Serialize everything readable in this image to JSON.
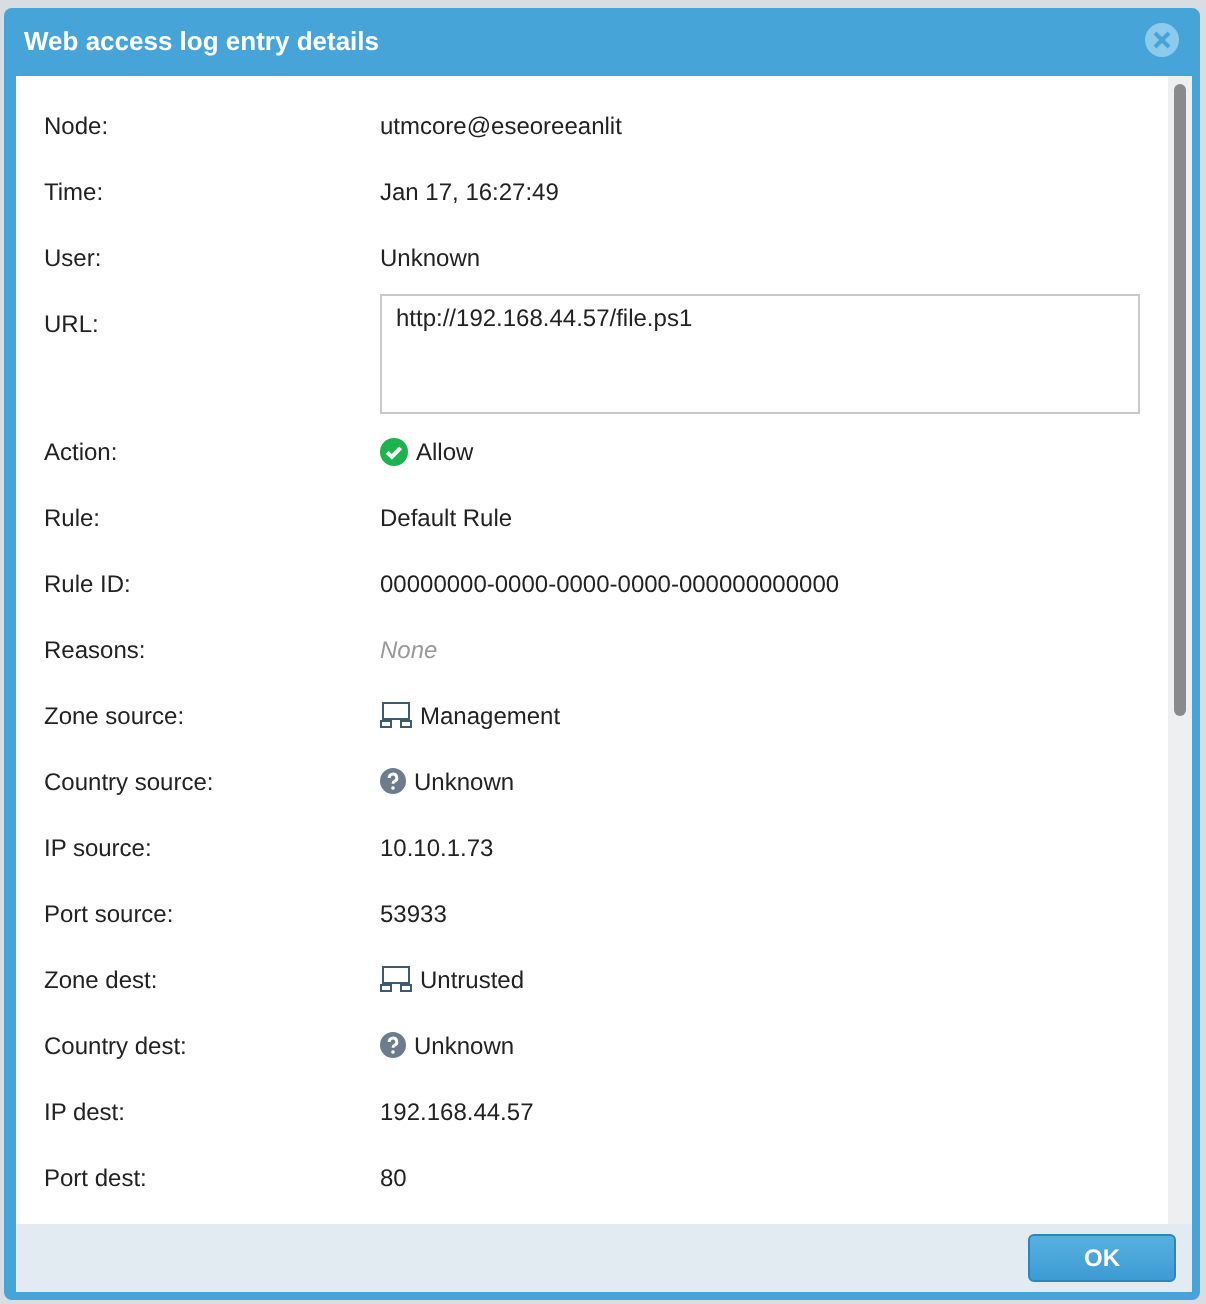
{
  "window": {
    "title": "Web access log entry details"
  },
  "fields": [
    {
      "label": "Node:",
      "kind": "text",
      "value": "utmcore@eseoreeanlit"
    },
    {
      "label": "Time:",
      "kind": "text",
      "value": "Jan 17, 16:27:49"
    },
    {
      "label": "User:",
      "kind": "text",
      "value": "Unknown"
    },
    {
      "label": "URL:",
      "kind": "textarea",
      "value": "http://192.168.44.57/file.ps1"
    },
    {
      "label": "Action:",
      "kind": "allow",
      "value": "Allow"
    },
    {
      "label": "Rule:",
      "kind": "text",
      "value": "Default Rule"
    },
    {
      "label": "Rule ID:",
      "kind": "text",
      "value": "00000000-0000-0000-0000-000000000000"
    },
    {
      "label": "Reasons:",
      "kind": "empty",
      "value": "None"
    },
    {
      "label": "Zone source:",
      "kind": "zone",
      "value": "Management"
    },
    {
      "label": "Country source:",
      "kind": "country",
      "value": "Unknown"
    },
    {
      "label": "IP source:",
      "kind": "text",
      "value": "10.10.1.73"
    },
    {
      "label": "Port source:",
      "kind": "text",
      "value": "53933"
    },
    {
      "label": "Zone dest:",
      "kind": "zone",
      "value": "Untrusted"
    },
    {
      "label": "Country dest:",
      "kind": "country",
      "value": "Unknown"
    },
    {
      "label": "IP dest:",
      "kind": "text",
      "value": "192.168.44.57"
    },
    {
      "label": "Port dest:",
      "kind": "text",
      "value": "80"
    }
  ],
  "buttons": [
    "OK"
  ]
}
